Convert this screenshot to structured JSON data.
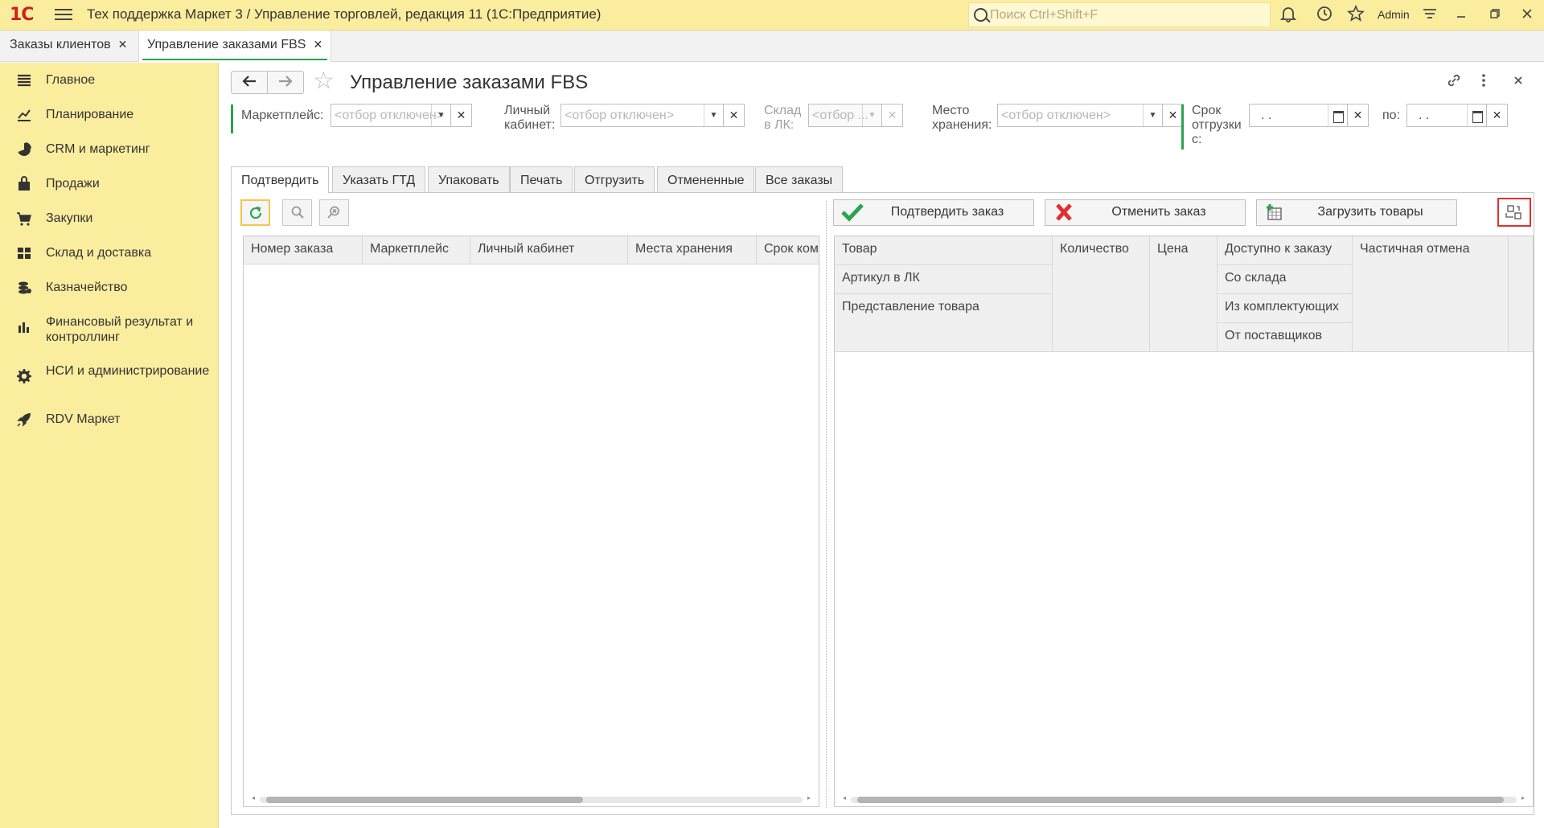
{
  "app": {
    "logo": "1С",
    "title": "Тех поддержка Маркет 3 / Управление торговлей, редакция 11  (1С:Предприятие)",
    "search_placeholder": "Поиск Ctrl+Shift+F",
    "user": "Admin"
  },
  "window_tabs": [
    {
      "label": "Заказы клиентов"
    },
    {
      "label": "Управление заказами FBS"
    }
  ],
  "sidebar": {
    "items": [
      {
        "label": "Главное",
        "icon": "menu-lines-icon"
      },
      {
        "label": "Планирование",
        "icon": "planning-chart-icon"
      },
      {
        "label": "CRM и маркетинг",
        "icon": "pie-chart-icon"
      },
      {
        "label": "Продажи",
        "icon": "shopping-bag-icon"
      },
      {
        "label": "Закупки",
        "icon": "cart-icon"
      },
      {
        "label": "Склад и доставка",
        "icon": "warehouse-grid-icon"
      },
      {
        "label": "Казначейство",
        "icon": "coins-icon"
      },
      {
        "label": "Финансовый результат и контроллинг",
        "icon": "bar-chart-icon"
      },
      {
        "label": "НСИ и администрирование",
        "icon": "gear-icon"
      },
      {
        "label": "RDV Маркет",
        "icon": "rocket-icon"
      }
    ]
  },
  "page": {
    "title": "Управление заказами FBS"
  },
  "filters": {
    "marketplace_label": "Маркетплейс:",
    "marketplace_placeholder": "<отбор отключен>",
    "cabinet_label_1": "Личный",
    "cabinet_label_2": "кабинет:",
    "cabinet_placeholder": "<отбор отключен>",
    "warehouse_label_1": "Склад",
    "warehouse_label_2": "в ЛК:",
    "warehouse_placeholder": "<отбор ...",
    "storage_label_1": "Место",
    "storage_label_2": "хранения:",
    "storage_placeholder": "<отбор отключен>",
    "ship_label_1": "Срок",
    "ship_label_2": "отгрузки",
    "ship_label_3": "с:",
    "ship_from_value": ".  .",
    "to_label": "по:",
    "ship_to_value": ".  ."
  },
  "form_tabs": [
    {
      "label": "Подтвердить"
    },
    {
      "label": "Указать ГТД"
    },
    {
      "label": "Упаковать"
    },
    {
      "label": "Печать"
    },
    {
      "label": "Отгрузить"
    },
    {
      "label": "Отмененные"
    },
    {
      "label": "Все заказы"
    }
  ],
  "actions": {
    "confirm_order": "Подтвердить заказ",
    "cancel_order": "Отменить заказ",
    "load_goods": "Загрузить товары"
  },
  "orders_table": {
    "columns": [
      "Номер заказа",
      "Маркетплейс",
      "Личный кабинет",
      "Места хранения",
      "Срок комплектации"
    ],
    "rows": []
  },
  "goods_table": {
    "columns": {
      "product": "Товар",
      "article": "Артикул в ЛК",
      "presentation": "Представление товара",
      "quantity": "Количество",
      "price": "Цена",
      "available": "Доступно к заказу",
      "from_stock": "Со склада",
      "from_components": "Из комплектующих",
      "from_suppliers": "От поставщиков",
      "partial_cancel": "Частичная отмена"
    },
    "rows": []
  },
  "colors": {
    "accent_yellow": "#fbed9e",
    "accent_green": "#2aa44f",
    "highlight_red": "#e03030"
  }
}
